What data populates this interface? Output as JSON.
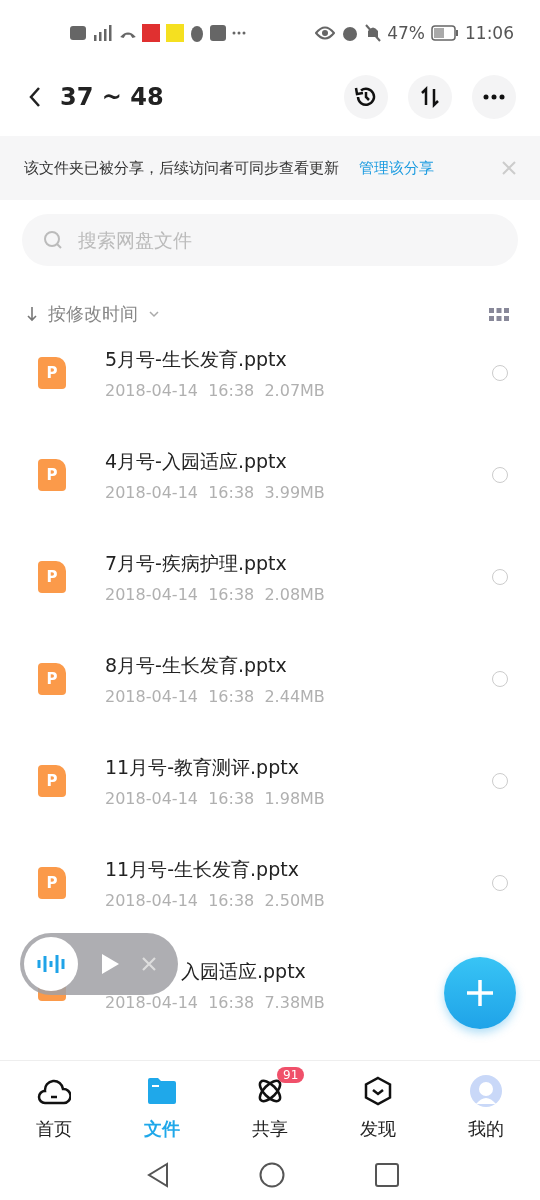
{
  "status_bar": {
    "battery": "47%",
    "time": "11:06"
  },
  "header": {
    "title": "37 ~ 48"
  },
  "banner": {
    "message": "该文件夹已被分享，后续访问者可同步查看更新",
    "link": "管理该分享"
  },
  "search": {
    "placeholder": "搜索网盘文件"
  },
  "sort": {
    "label": "按修改时间"
  },
  "files": [
    {
      "badge": "P",
      "name": "5月号-生长发育.pptx",
      "date": "2018-04-14",
      "time": "16:38",
      "size": "2.07MB",
      "selected": false
    },
    {
      "badge": "P",
      "name": "4月号-入园适应.pptx",
      "date": "2018-04-14",
      "time": "16:38",
      "size": "3.99MB",
      "selected": false
    },
    {
      "badge": "P",
      "name": "7月号-疾病护理.pptx",
      "date": "2018-04-14",
      "time": "16:38",
      "size": "2.08MB",
      "selected": false
    },
    {
      "badge": "P",
      "name": "8月号-生长发育.pptx",
      "date": "2018-04-14",
      "time": "16:38",
      "size": "2.44MB",
      "selected": false
    },
    {
      "badge": "P",
      "name": "11月号-教育测评.pptx",
      "date": "2018-04-14",
      "time": "16:38",
      "size": "1.98MB",
      "selected": false
    },
    {
      "badge": "P",
      "name": "11月号-生长发育.pptx",
      "date": "2018-04-14",
      "time": "16:38",
      "size": "2.50MB",
      "selected": false
    },
    {
      "name": "入园适应.pptx",
      "date": "2018-04-14",
      "time": "16:38",
      "size": "7.38MB"
    }
  ],
  "nav": [
    {
      "kind": "home",
      "label": "首页",
      "selected": false
    },
    {
      "kind": "files",
      "label": "文件",
      "selected": true
    },
    {
      "kind": "share",
      "label": "共享",
      "selected": false,
      "badge": "91"
    },
    {
      "kind": "discover",
      "label": "发现",
      "selected": false
    },
    {
      "kind": "me",
      "label": "我的",
      "selected": false
    }
  ]
}
